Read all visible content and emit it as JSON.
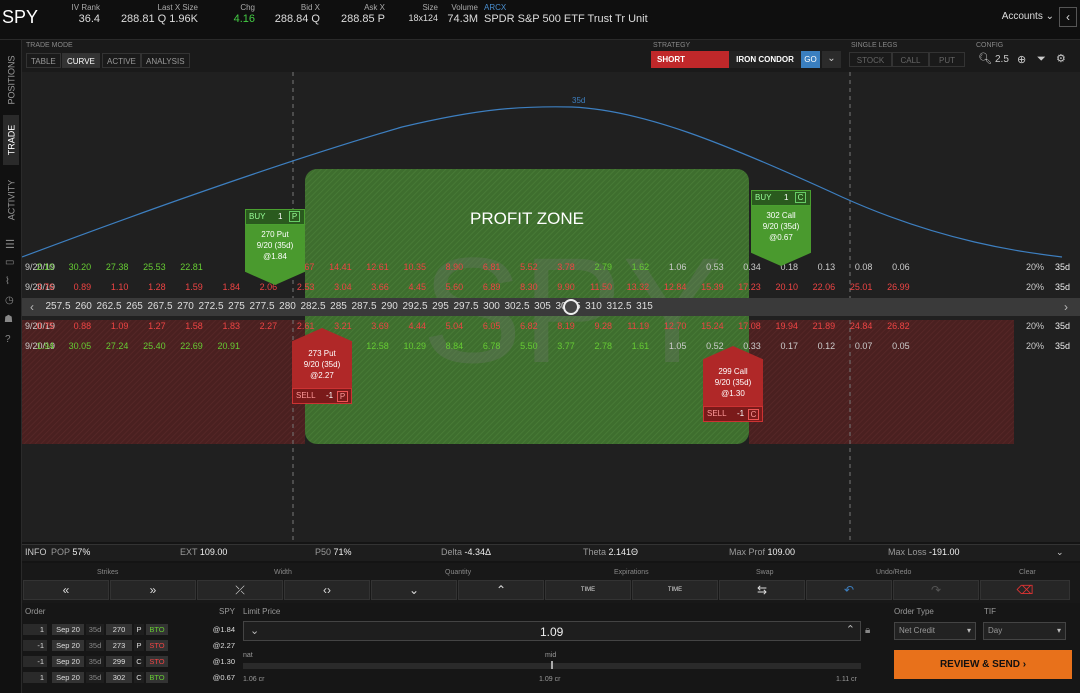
{
  "header": {
    "symbol": "SPY",
    "quotes": [
      {
        "label": "IV Rank",
        "value": "36.4"
      },
      {
        "label": "Last X Size",
        "value": "288.81 Q 1.96K"
      },
      {
        "label": "Chg",
        "value": "4.16"
      },
      {
        "label": "Bid X",
        "value": "288.84 Q"
      },
      {
        "label": "Ask X",
        "value": "288.85 P"
      },
      {
        "label": "Size",
        "value": "18x124"
      },
      {
        "label": "Volume",
        "value": "74.3M"
      }
    ],
    "exchange": "ARCX",
    "description": "SPDR S&P 500 ETF Trust Tr Unit",
    "accounts": "Accounts"
  },
  "sidebar": {
    "positions": "POSITIONS",
    "trade": "TRADE",
    "activity": "ACTIVITY"
  },
  "toolbar": {
    "trade_mode_label": "TRADE MODE",
    "modes": [
      "TABLE",
      "CURVE",
      "ACTIVE",
      "ANALYSIS"
    ],
    "strategy_label": "STRATEGY",
    "side": "SHORT",
    "strategy": "IRON CONDOR",
    "go": "GO",
    "single_legs_label": "SINGLE LEGS",
    "legs": [
      "STOCK",
      "CALL",
      "PUT"
    ],
    "config_label": "CONFIG",
    "zoom": "2.5"
  },
  "chart": {
    "curve_label": "35d",
    "profit_zone": "PROFIT ZONE",
    "watermark": "SPY",
    "rows": [
      {
        "date": "9/20/19",
        "vals": [
          "2.10",
          "30.20",
          "27.38",
          "25.53",
          "22.81",
          "",
          "18.80",
          "16.67",
          "14.41",
          "12.61",
          "10.35",
          "8.90",
          "6.81",
          "5.52",
          "3.78",
          "2.79",
          "1.62",
          "1.06",
          "0.53",
          "0.34",
          "0.18",
          "0.13",
          "0.08",
          "0.06"
        ],
        "pct": "20%",
        "dte": "35d"
      },
      {
        "date": "9/20/19",
        "vals": [
          "3.76",
          "0.89",
          "1.10",
          "1.28",
          "1.59",
          "1.84",
          "2.06",
          "2.53",
          "3.04",
          "3.66",
          "4.45",
          "5.60",
          "6.89",
          "8.30",
          "9.90",
          "11.50",
          "13.32",
          "12.84",
          "15.39",
          "17.23",
          "20.10",
          "22.06",
          "25.01",
          "26.99"
        ],
        "pct": "20%",
        "dte": "35d"
      },
      {
        "date": "9/20/19",
        "vals": [
          "0.75",
          "0.88",
          "1.09",
          "1.27",
          "1.58",
          "1.83",
          "2.27",
          "2.61",
          "3.21",
          "3.69",
          "4.44",
          "5.04",
          "6.05",
          "6.82",
          "8.19",
          "9.28",
          "11.19",
          "12.70",
          "15.24",
          "17.08",
          "19.94",
          "21.89",
          "24.84",
          "26.82"
        ],
        "pct": "20%",
        "dte": "35d"
      },
      {
        "date": "9/20/19",
        "vals": [
          "1.94",
          "30.05",
          "27.24",
          "25.40",
          "22.69",
          "20.91",
          "",
          "16.62",
          "14.16",
          "12.58",
          "10.29",
          "8.84",
          "6.78",
          "5.50",
          "3.77",
          "2.78",
          "1.61",
          "1.05",
          "0.52",
          "0.33",
          "0.17",
          "0.12",
          "0.07",
          "0.05"
        ],
        "pct": "20%",
        "dte": "35d"
      }
    ],
    "strikes": [
      "257.5",
      "260",
      "262.5",
      "265",
      "267.5",
      "270",
      "272.5",
      "275",
      "277.5",
      "280",
      "282.5",
      "285",
      "287.5",
      "290",
      "292.5",
      "295",
      "297.5",
      "300",
      "302.5",
      "305",
      "307.5",
      "310",
      "312.5",
      "315"
    ],
    "legs": {
      "buy_put": {
        "action": "BUY",
        "qty": "1",
        "type": "P",
        "desc": "270 Put",
        "exp": "9/20 (35d)",
        "price": "@1.84"
      },
      "buy_call": {
        "action": "BUY",
        "qty": "1",
        "type": "C",
        "desc": "302 Call",
        "exp": "9/20 (35d)",
        "price": "@0.67"
      },
      "sell_put": {
        "action": "SELL",
        "qty": "-1",
        "type": "P",
        "desc": "273 Put",
        "exp": "9/20 (35d)",
        "price": "@2.27"
      },
      "sell_call": {
        "action": "SELL",
        "qty": "-1",
        "type": "C",
        "desc": "299 Call",
        "exp": "9/20 (35d)",
        "price": "@1.30"
      }
    }
  },
  "info": {
    "label": "INFO",
    "pop_label": "POP",
    "pop": "57%",
    "ext_label": "EXT",
    "ext": "109.00",
    "p50_label": "P50",
    "p50": "71%",
    "delta_label": "Delta",
    "delta": "-4.34Δ",
    "theta_label": "Theta",
    "theta": "2.141Θ",
    "maxprof_label": "Max Prof",
    "maxprof": "109.00",
    "maxloss_label": "Max Loss",
    "maxloss": "-191.00"
  },
  "controls": {
    "strikes": "Strikes",
    "width": "Width",
    "quantity": "Quantity",
    "expirations": "Expirations",
    "swap": "Swap",
    "undo_redo": "Undo/Redo",
    "clear": "Clear",
    "time": "TIME"
  },
  "order": {
    "label": "Order",
    "spy_label": "SPY",
    "limit_label": "Limit Price",
    "limit": "1.09",
    "nat_label": "nat",
    "mid_label": "mid",
    "nat": "1.06 cr",
    "mid": "1.09 cr",
    "far": "1.11 cr",
    "order_type_label": "Order Type",
    "order_type": "Net Credit",
    "tif_label": "TIF",
    "tif": "Day",
    "submit": "REVIEW & SEND",
    "rows": [
      {
        "qty": "1",
        "exp": "Sep 20",
        "dte": "35d",
        "strike": "270",
        "type": "P",
        "oc": "BTO",
        "price": "@1.84"
      },
      {
        "qty": "-1",
        "exp": "Sep 20",
        "dte": "35d",
        "strike": "273",
        "type": "P",
        "oc": "STO",
        "price": "@2.27"
      },
      {
        "qty": "-1",
        "exp": "Sep 20",
        "dte": "35d",
        "strike": "299",
        "type": "C",
        "oc": "STO",
        "price": "@1.30"
      },
      {
        "qty": "1",
        "exp": "Sep 20",
        "dte": "35d",
        "strike": "302",
        "type": "C",
        "oc": "BTO",
        "price": "@0.67"
      }
    ]
  }
}
